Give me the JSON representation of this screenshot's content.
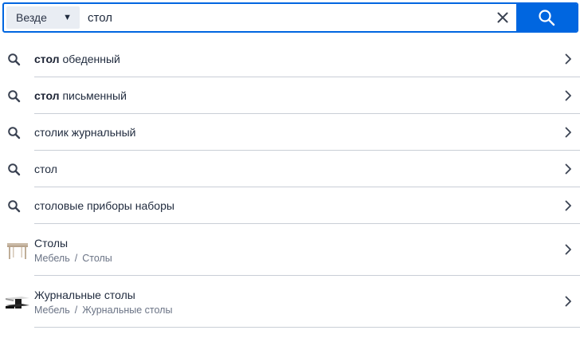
{
  "search": {
    "scope_label": "Везде",
    "query": "стол",
    "caret_icon": "caret-down-icon",
    "clear_icon": "close-icon",
    "submit_icon": "search-icon",
    "accent_color": "#0066e0"
  },
  "suggestions": [
    {
      "bold": "стол",
      "rest": " обеденный"
    },
    {
      "bold": "стол",
      "rest": " письменный"
    },
    {
      "bold": "",
      "rest": "столик журнальный"
    },
    {
      "bold": "",
      "rest": "стол"
    },
    {
      "bold": "",
      "rest": "столовые приборы наборы"
    }
  ],
  "categories": [
    {
      "title": "Столы",
      "crumbs": [
        "Мебель",
        "Столы"
      ],
      "sep": "/",
      "thumb": "table-thumbnail"
    },
    {
      "title": "Журнальные столы",
      "crumbs": [
        "Мебель",
        "Журнальные столы"
      ],
      "sep": "/",
      "thumb": "coffee-table-thumbnail"
    }
  ]
}
